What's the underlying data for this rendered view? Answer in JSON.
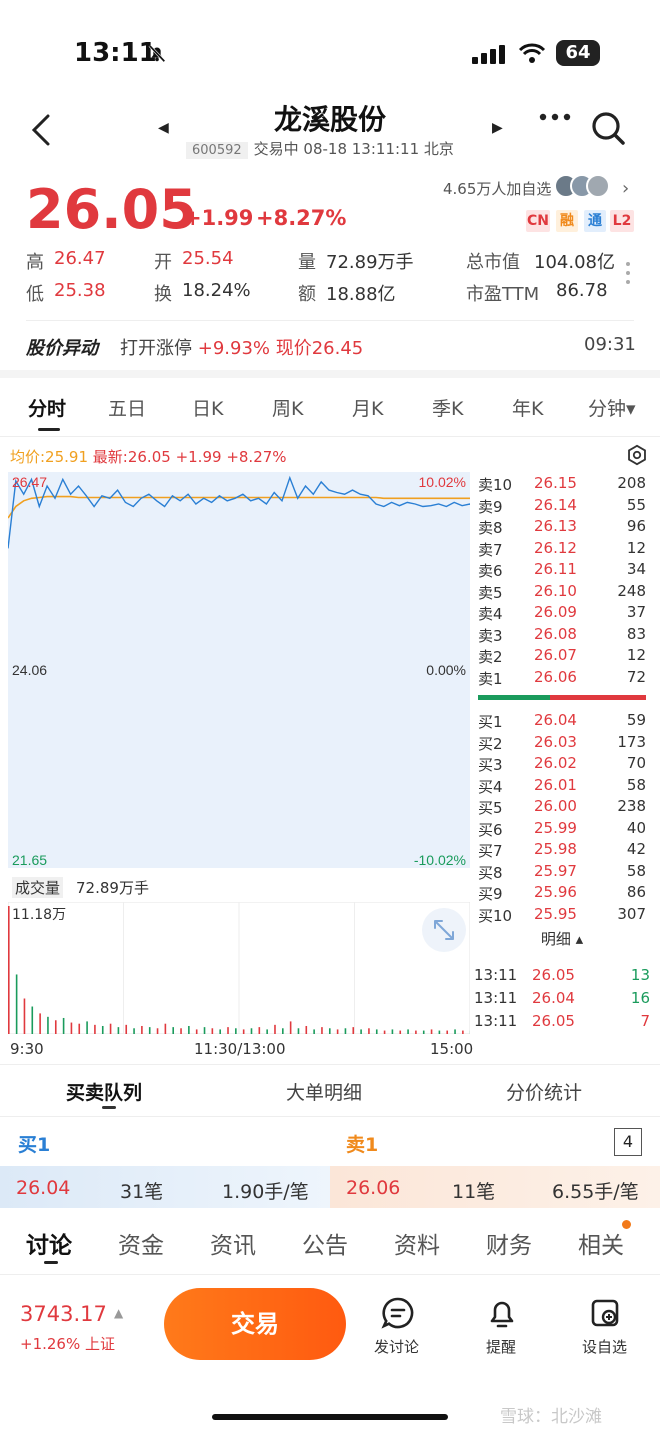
{
  "status_bar": {
    "time": "13:11",
    "battery": "64"
  },
  "header": {
    "stock_name": "龙溪股份",
    "stock_code": "600592",
    "status_line": "交易中 08-18 13:11:11 北京",
    "prev_arrow": "◀",
    "next_arrow": "▶"
  },
  "quote": {
    "price": "26.05",
    "change": "+1.99",
    "change_pct": "+8.27%",
    "followers": "4.65万人加自选",
    "badges": {
      "cn": "CN",
      "rong": "融",
      "tong": "通",
      "l2": "L2"
    },
    "fields": [
      {
        "label": "高",
        "value": "26.47",
        "color": "red"
      },
      {
        "label": "开",
        "value": "25.54",
        "color": "red"
      },
      {
        "label": "量",
        "value": "72.89万手",
        "color": "dark"
      },
      {
        "label": "总市值",
        "value": "104.08亿",
        "color": "dark"
      },
      {
        "label": "低",
        "value": "25.38",
        "color": "red"
      },
      {
        "label": "换",
        "value": "18.24%",
        "color": "dark"
      },
      {
        "label": "额",
        "value": "18.88亿",
        "color": "dark"
      },
      {
        "label": "市盈TTM",
        "value": "86.78",
        "color": "dark"
      }
    ]
  },
  "alert": {
    "title": "股价异动",
    "text_prefix": "打开涨停",
    "text_pct": "+9.93%",
    "text_now": "现价26.45",
    "time": "09:31"
  },
  "chart_tabs": [
    "分时",
    "五日",
    "日K",
    "周K",
    "月K",
    "季K",
    "年K",
    "分钟▾"
  ],
  "chart_info": {
    "avg_label": "均价:25.91",
    "latest_label": "最新:26.05",
    "change": "+1.99",
    "change_pct": "+8.27%"
  },
  "chart_data": {
    "type": "line",
    "title": "",
    "y_axis_left": [
      "26.47",
      "24.06",
      "21.65"
    ],
    "y_axis_right": [
      "10.02%",
      "0.00%",
      "-10.02%"
    ],
    "ylim": [
      21.65,
      26.47
    ],
    "x_ticks": [
      "9:30",
      "11:30/13:00",
      "15:00"
    ],
    "series": [
      {
        "name": "最新",
        "color": "#2a7fd4",
        "values": [
          25.54,
          26.36,
          26.2,
          26.38,
          26.05,
          26.3,
          26.15,
          26.38,
          26.2,
          26.3,
          26.18,
          26.05,
          26.18,
          26.15,
          26.25,
          26.1,
          26.05,
          26.15,
          26.2,
          26.12,
          26.05,
          26.18,
          26.12,
          26.2,
          26.08,
          26.15,
          26.1,
          26.18,
          26.12,
          26.15,
          26.2,
          26.12,
          26.15,
          26.08,
          26.22,
          26.12,
          26.4,
          26.15,
          26.3,
          26.2,
          26.35,
          26.25,
          26.22,
          26.2,
          26.25,
          26.2,
          26.18,
          26.08,
          26.05,
          26.1,
          26.06,
          26.1,
          26.08,
          26.05,
          26.06,
          26.08,
          26.05,
          26.1,
          26.06,
          26.08,
          26.05,
          26.06,
          26.05,
          26.15,
          26.05,
          26.35,
          26.25,
          26.32
        ]
      },
      {
        "name": "均价",
        "color": "#f0a020",
        "values": [
          25.91,
          26.05,
          26.12,
          26.15,
          26.16,
          26.17,
          26.17,
          26.17,
          26.17,
          26.16,
          26.16,
          26.16,
          26.16,
          26.16,
          26.16,
          26.16,
          26.16,
          26.16,
          26.16,
          26.16,
          26.16,
          26.16,
          26.16,
          26.16,
          26.16,
          26.16,
          26.16,
          26.16,
          26.16,
          26.16,
          26.16,
          26.16,
          26.16,
          26.16,
          26.16,
          26.16,
          26.16,
          26.16,
          26.16,
          26.16,
          26.16,
          26.16,
          26.16,
          26.16,
          26.16,
          26.16,
          26.16,
          26.16,
          26.15,
          26.15,
          26.15,
          26.15,
          26.15,
          26.15,
          26.15,
          26.15,
          26.15,
          26.15,
          26.15,
          26.15,
          26.15,
          26.15,
          26.15,
          26.15,
          26.15,
          26.15,
          26.15,
          26.15
        ]
      }
    ],
    "volume": {
      "label": "成交量",
      "total": "72.89万手",
      "max_label": "11.18万",
      "bars": [
        11.18,
        5.2,
        3.1,
        2.4,
        1.8,
        1.5,
        1.2,
        1.4,
        1.0,
        0.9,
        1.1,
        0.8,
        0.7,
        0.9,
        0.6,
        0.8,
        0.5,
        0.7,
        0.6,
        0.5,
        0.9,
        0.6,
        0.5,
        0.7,
        0.4,
        0.6,
        0.5,
        0.4,
        0.6,
        0.5,
        0.4,
        0.5,
        0.6,
        0.4,
        0.8,
        0.5,
        1.1,
        0.5,
        0.7,
        0.4,
        0.6,
        0.5,
        0.4,
        0.5,
        0.6,
        0.4,
        0.5,
        0.4,
        0.3,
        0.4,
        0.3,
        0.4,
        0.3,
        0.3,
        0.4,
        0.3,
        0.3,
        0.4,
        0.3,
        0.3,
        0.4,
        0.3,
        0.4,
        0.8,
        0.5,
        0.6,
        0.4,
        0.5
      ],
      "bar_up": [
        true,
        false,
        true,
        false,
        true,
        false,
        true,
        false,
        true,
        true,
        false,
        true,
        false,
        true,
        false,
        true,
        false,
        true,
        false,
        true,
        true,
        false,
        true,
        false,
        true,
        false,
        true,
        false,
        true,
        false,
        true,
        false,
        true,
        false,
        true,
        false,
        true,
        false,
        true,
        false,
        true,
        false,
        true,
        false,
        true,
        false,
        true,
        false,
        true,
        false,
        true,
        false,
        true,
        false,
        true,
        false,
        true,
        false,
        true,
        false,
        true,
        false,
        true,
        true,
        false,
        true,
        false,
        true
      ]
    }
  },
  "order_book": {
    "asks": [
      {
        "label": "卖10",
        "price": "26.15",
        "vol": "208"
      },
      {
        "label": "卖9",
        "price": "26.14",
        "vol": "55"
      },
      {
        "label": "卖8",
        "price": "26.13",
        "vol": "96"
      },
      {
        "label": "卖7",
        "price": "26.12",
        "vol": "12"
      },
      {
        "label": "卖6",
        "price": "26.11",
        "vol": "34"
      },
      {
        "label": "卖5",
        "price": "26.10",
        "vol": "248"
      },
      {
        "label": "卖4",
        "price": "26.09",
        "vol": "37"
      },
      {
        "label": "卖3",
        "price": "26.08",
        "vol": "83"
      },
      {
        "label": "卖2",
        "price": "26.07",
        "vol": "12"
      },
      {
        "label": "卖1",
        "price": "26.06",
        "vol": "72"
      }
    ],
    "bids": [
      {
        "label": "买1",
        "price": "26.04",
        "vol": "59"
      },
      {
        "label": "买2",
        "price": "26.03",
        "vol": "173"
      },
      {
        "label": "买3",
        "price": "26.02",
        "vol": "70"
      },
      {
        "label": "买4",
        "price": "26.01",
        "vol": "58"
      },
      {
        "label": "买5",
        "price": "26.00",
        "vol": "238"
      },
      {
        "label": "买6",
        "price": "25.99",
        "vol": "40"
      },
      {
        "label": "买7",
        "price": "25.98",
        "vol": "42"
      },
      {
        "label": "买8",
        "price": "25.97",
        "vol": "58"
      },
      {
        "label": "买9",
        "price": "25.96",
        "vol": "86"
      },
      {
        "label": "买10",
        "price": "25.95",
        "vol": "307"
      }
    ],
    "buy_sell_ratio": 0.43,
    "detail_tab": "明细 ▴",
    "ticks": [
      {
        "time": "13:11",
        "price": "26.05",
        "vol": "13"
      },
      {
        "time": "13:11",
        "price": "26.04",
        "vol": "16"
      },
      {
        "time": "13:11",
        "price": "26.05",
        "vol": "7"
      }
    ]
  },
  "sub_tabs": [
    "买卖队列",
    "大单明细",
    "分价统计"
  ],
  "queue": {
    "buy_title": "买1",
    "sell_title": "卖1",
    "count": "4",
    "buy": {
      "price": "26.04",
      "orders": "31笔",
      "avg": "1.90手/笔"
    },
    "sell": {
      "price": "26.06",
      "orders": "11笔",
      "avg": "6.55手/笔"
    }
  },
  "content_tabs": [
    "讨论",
    "资金",
    "资讯",
    "公告",
    "资料",
    "财务",
    "相关"
  ],
  "bottom_bar": {
    "index_value": "3743.17",
    "index_change": "+1.26%",
    "index_name": "上证",
    "trade": "交易",
    "discuss": "发讨论",
    "remind": "提醒",
    "watchlist": "设自选"
  },
  "watermark": "雪球：北沙滩",
  "colors": {
    "up": "#e0393e",
    "down": "#1a9b5c",
    "accent": "#ff6a14",
    "line": "#2a7fd4",
    "avg": "#f0a020"
  }
}
